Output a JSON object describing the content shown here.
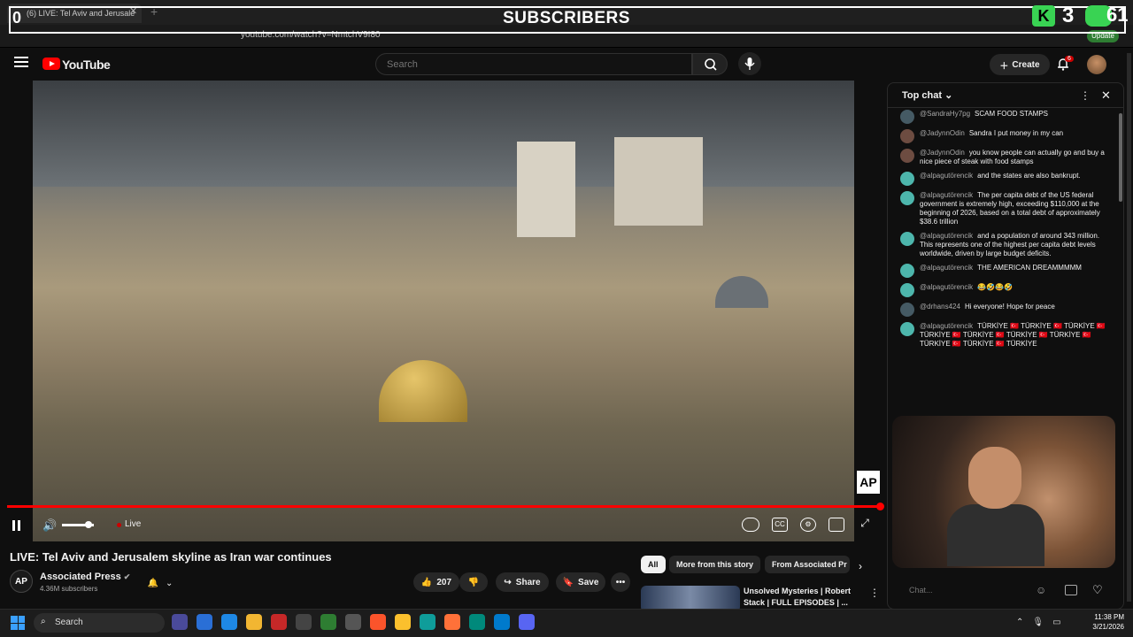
{
  "browser": {
    "tab_title": "(6) LIVE: Tel Aviv and Jerusale",
    "new_tab": "+",
    "close": "✕",
    "url": "youtube.com/watch?v=NmtchV9I80",
    "update_label": "Update"
  },
  "overlay": {
    "title": "SUBSCRIBERS",
    "left_count": "0",
    "k_label": "K",
    "k_count": "3",
    "play_count": "61"
  },
  "header": {
    "brand": "YouTube",
    "search_placeholder": "Search",
    "create_label": "Create",
    "notifications_count": "6"
  },
  "video": {
    "live_label": "Live",
    "ap_logo": "AP",
    "progress_fraction": 1.0,
    "title": "LIVE: Tel Aviv and Jerusalem skyline as Iran war continues"
  },
  "channel": {
    "avatar_text": "AP",
    "name": "Associated Press",
    "subscribers": "4.36M subscribers"
  },
  "actions": {
    "likes": "207",
    "share": "Share",
    "save": "Save",
    "more": "•••"
  },
  "recommendations": {
    "chips": [
      "All",
      "More from this story",
      "From Associated Pr"
    ],
    "item_title": "Unsolved Mysteries | Robert Stack | FULL EPISODES | ..."
  },
  "chat": {
    "title": "Top chat",
    "input_placeholder": "Chat...",
    "messages": [
      {
        "user": "@SandraHy7pg",
        "text": "SCAM FOOD STAMPS"
      },
      {
        "user": "@JadynnOdin",
        "text": "Sandra I put money in my can"
      },
      {
        "user": "@JadynnOdin",
        "text": "you know people can actually go and buy a nice piece of steak with food stamps"
      },
      {
        "user": "@alpagutörencik",
        "text": "and the states are also bankrupt."
      },
      {
        "user": "@alpagutörencik",
        "text": "The per capita debt of the US federal government is extremely high, exceeding $110,000 at the beginning of 2026, based on a total debt of approximately $38.6 trillion"
      },
      {
        "user": "@alpagutörencik",
        "text": "and a population of around 343 million. This represents one of the highest per capita debt levels worldwide, driven by large budget deficits."
      },
      {
        "user": "@alpagutörencik",
        "text": "THE AMERICAN DREAMMMMM"
      },
      {
        "user": "@alpagutörencik",
        "text": "😂🤣😂🤣"
      },
      {
        "user": "@drhans424",
        "text": "Hi everyone! Hope for peace"
      },
      {
        "user": "@alpagutörencik",
        "text": "TÜRKİYE 🇹🇷 TÜRKİYE 🇹🇷 TÜRKİYE 🇹🇷 TÜRKİYE 🇹🇷 TÜRKİYE 🇹🇷 TÜRKİYE 🇹🇷 TÜRKİYE 🇹🇷 TÜRKİYE 🇹🇷 TÜRKİYE 🇹🇷 TÜRKİYE"
      }
    ]
  },
  "taskbar": {
    "search_label": "Search",
    "time": "11:38 PM",
    "date": "3/21/2026"
  }
}
